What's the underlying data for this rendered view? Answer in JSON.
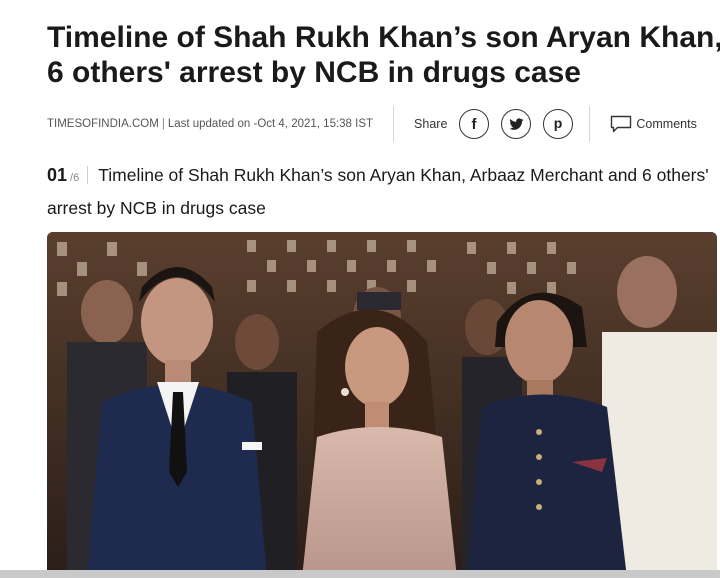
{
  "article": {
    "headline_line1": "Timeline of Shah Rukh Khan’s son Aryan Khan,",
    "headline_line2": "6 others' arrest by NCB in drugs case",
    "source": "TIMESOFINDIA.COM",
    "separator": "|",
    "updated": "Last updated on -Oct 4, 2021, 15:38 IST"
  },
  "share": {
    "label": "Share",
    "buttons": [
      {
        "name": "facebook",
        "glyph": "f",
        "icon": "facebook-icon"
      },
      {
        "name": "twitter",
        "icon": "twitter-icon"
      },
      {
        "name": "pinterest",
        "glyph": "p",
        "icon": "pinterest-icon"
      }
    ],
    "comment_label": "Comments",
    "comment_icon": "speech-bubble-icon"
  },
  "slide": {
    "number": "01",
    "total": "/6",
    "caption": "Timeline of Shah Rukh Khan’s son Aryan Khan, Arbaaz Merchant and 6 others' arrest by NCB in drugs case"
  },
  "photo": {
    "subject": "photo-of-people-at-event"
  },
  "colors": {
    "text": "#1a1a1a",
    "muted": "#555555",
    "divider": "#d6d6d6"
  }
}
